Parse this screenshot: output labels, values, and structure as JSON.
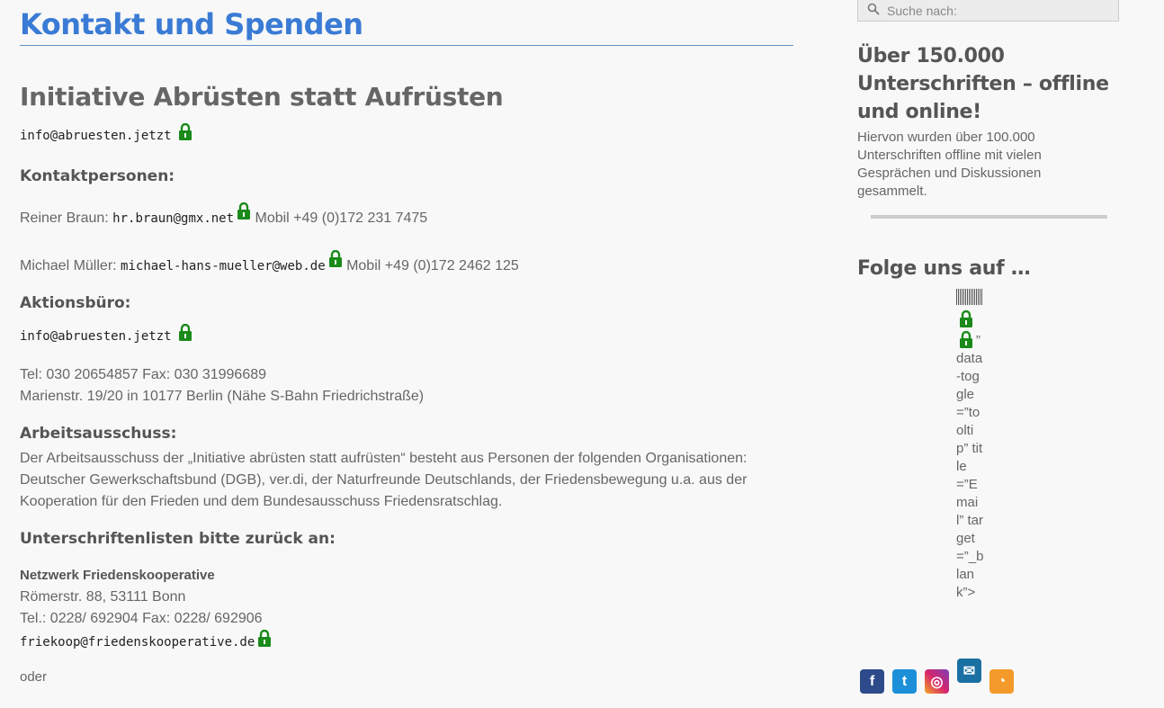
{
  "page": {
    "title": "Kontakt und Spenden"
  },
  "initiative": {
    "title": "Initiative Abrüsten statt Aufrüsten",
    "email": "info@abruesten.jetzt"
  },
  "kontakt": {
    "heading": "Kontaktpersonen:",
    "persons": [
      {
        "label": "Reiner Braun:",
        "email": "hr.braun@gmx.net",
        "phone": "Mobil +49 (0)172 231 7475"
      },
      {
        "label": "Michael Müller:",
        "email": "michael-hans-mueller@web.de",
        "phone": "Mobil +49 (0)172 2462 125"
      }
    ]
  },
  "buero": {
    "heading": "Aktionsbüro:",
    "email": "info@abruesten.jetzt",
    "tel": "Tel: 030 20654857 Fax: 030 31996689",
    "address": "Marienstr. 19/20 in 10177 Berlin (Nähe S-Bahn Friedrichstraße)"
  },
  "ausschuss": {
    "heading": "Arbeitsausschuss:",
    "text": "Der Arbeitsausschuss der „Initiative abrüsten statt aufrüsten“ besteht aus Personen der folgenden Organisationen: Deutscher Gewerkschaftsbund (DGB), ver.di, der Naturfreunde Deutschlands, der Friedensbewegung u.a. aus der Kooperation für den Frieden und dem Bundesausschuss Friedensratschlag."
  },
  "listen": {
    "heading": "Unterschriftenlisten bitte zurück an:",
    "org": "Netzwerk Friedenskooperative",
    "address": "Römerstr. 88, 53111 Bonn",
    "tel": "Tel.: 0228/ 692904 Fax: 0228/ 692906",
    "email": "friekoop@friedenskooperative.de",
    "oder": "oder"
  },
  "sidebar": {
    "search_placeholder": "Suche nach:",
    "headline": "Über 150.000 Unterschriften – offline und online!",
    "text": "Hiervon wurden über 100.000 Unterschriften offline mit vielen Gesprächen und Diskussionen gesammelt.",
    "follow": "Folge uns auf …",
    "junk": "” data-toggle=”tooltip” title=”Email” target=”_blank”>"
  },
  "social": {
    "facebook": "f",
    "twitter": "t",
    "instagram": "◎",
    "email": "✉",
    "rss": "◔"
  },
  "colors": {
    "title": "#3a7bd5",
    "lock": "#1a8a1a"
  }
}
